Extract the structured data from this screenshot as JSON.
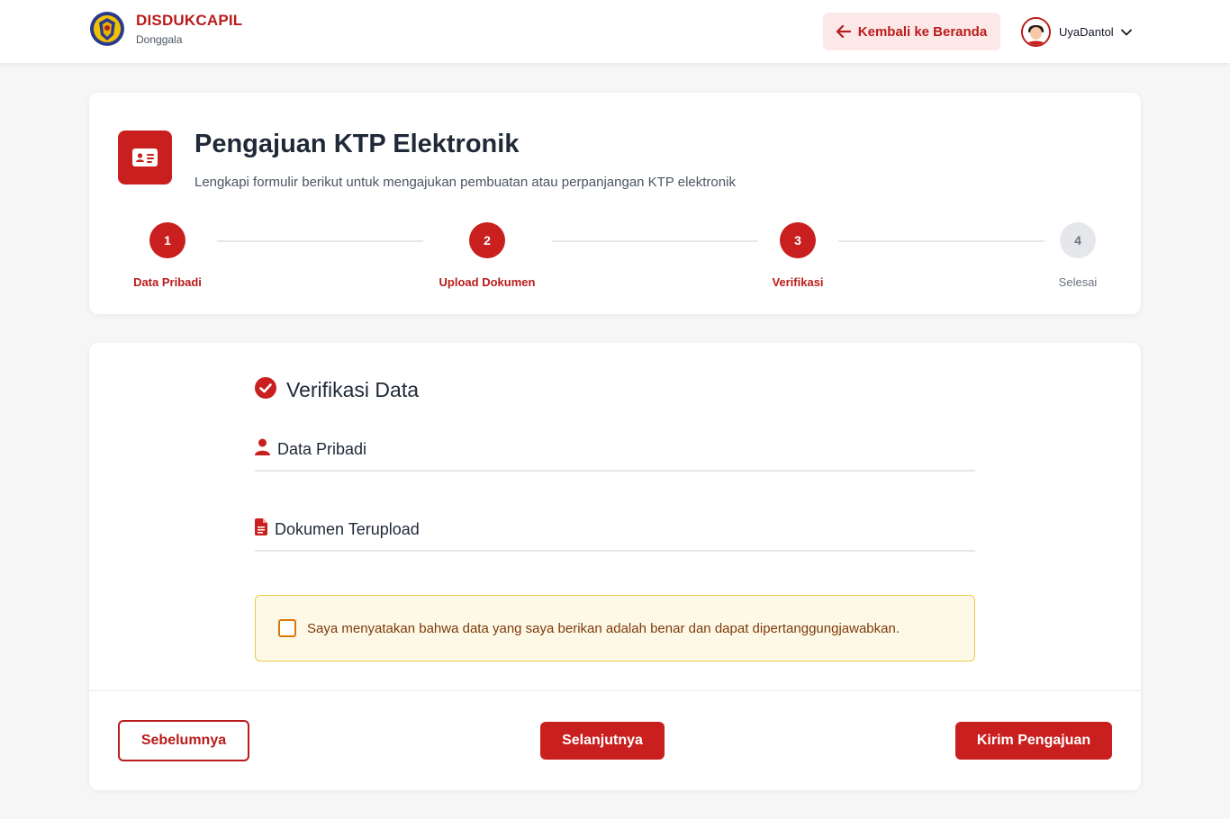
{
  "header": {
    "brand_title": "DISDUKCAPIL",
    "brand_subtitle": "Donggala",
    "back_label": "Kembali ke Beranda",
    "user_name": "UyaDantol"
  },
  "page": {
    "title": "Pengajuan KTP Elektronik",
    "description": "Lengkapi formulir berikut untuk mengajukan pembuatan atau perpanjangan KTP elektronik"
  },
  "steps": [
    {
      "number": "1",
      "label": "Data Pribadi",
      "state": "active"
    },
    {
      "number": "2",
      "label": "Upload Dokumen",
      "state": "active"
    },
    {
      "number": "3",
      "label": "Verifikasi",
      "state": "active"
    },
    {
      "number": "4",
      "label": "Selesai",
      "state": "inactive"
    }
  ],
  "verification": {
    "title": "Verifikasi Data",
    "personal_data_title": "Data Pribadi",
    "documents_title": "Dokumen Terupload",
    "agreement_text": "Saya menyatakan bahwa data yang saya berikan adalah benar dan dapat dipertanggungjawabkan.",
    "agreement_checked": false
  },
  "actions": {
    "prev_label": "Sebelumnya",
    "next_label": "Selanjutnya",
    "submit_label": "Kirim Pengajuan"
  },
  "colors": {
    "primary": "#c91f1f",
    "primary_text": "#b91c1c",
    "notice_bg": "#fef9e7",
    "notice_border": "#f0c94a"
  },
  "icons": {
    "logo": "government-emblem-logo",
    "back": "arrow-left-icon",
    "user_menu": "chevron-down-icon",
    "header_card": "id-card-icon",
    "verification": "check-circle-icon",
    "personal": "user-icon",
    "documents": "file-icon"
  }
}
